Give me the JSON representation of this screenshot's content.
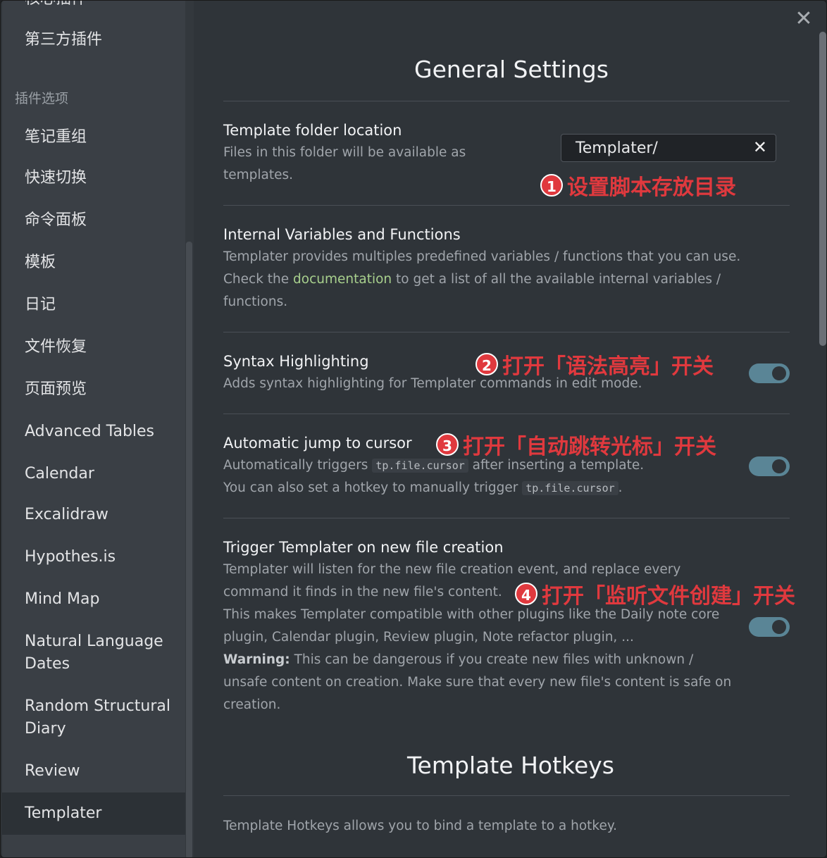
{
  "sidebar": {
    "top_partial": "核心插件",
    "items_top": [
      "第三方插件"
    ],
    "section_label": "插件选项",
    "items": [
      "笔记重组",
      "快速切换",
      "命令面板",
      "模板",
      "日记",
      "文件恢复",
      "页面预览",
      "Advanced Tables",
      "Calendar",
      "Excalidraw",
      "Hypothes.is",
      "Mind Map",
      "Natural Language\nDates",
      "Random Structural\nDiary",
      "Review",
      "Templater"
    ],
    "active": "Templater"
  },
  "dialog": {
    "close_icon": "✕"
  },
  "general": {
    "heading": "General Settings",
    "folder": {
      "title": "Template folder location",
      "desc": "Files in this folder will be available as templates.",
      "value": "Templater/",
      "clear_icon": "✕"
    },
    "internal": {
      "title": "Internal Variables and Functions",
      "desc1": "Templater provides multiples predefined variables / functions that you can use.",
      "desc2_pre": "Check the ",
      "desc2_link": "documentation",
      "desc2_post": " to get a list of all the available internal variables / functions."
    },
    "syntax": {
      "title": "Syntax Highlighting",
      "desc": "Adds syntax highlighting for Templater commands in edit mode.",
      "enabled": true
    },
    "jump": {
      "title": "Automatic jump to cursor",
      "desc_a": "Automatically triggers ",
      "code": "tp.file.cursor",
      "desc_b": " after inserting a template.",
      "desc_c": "You can also set a hotkey to manually trigger ",
      "desc_d": ".",
      "enabled": true
    },
    "trigger": {
      "title": "Trigger Templater on new file creation",
      "desc1": "Templater will listen for the new file creation event, and replace every",
      "desc2": "command it finds in the new file's content.",
      "desc3": "This makes Templater compatible with other plugins like the Daily note core",
      "desc4": "plugin, Calendar plugin, Review plugin, Note refactor plugin, ...",
      "warn_label": "Warning:",
      "desc5": " This can be dangerous if you create new files with unknown /",
      "desc6": "unsafe content on creation. Make sure that every new file's content is safe on",
      "desc7": "creation.",
      "enabled": true
    }
  },
  "hotkeys": {
    "heading": "Template Hotkeys",
    "desc": "Template Hotkeys allows you to bind a template to a hotkey."
  },
  "annotations": [
    {
      "num": "1",
      "text": "设置脚本存放目录"
    },
    {
      "num": "2",
      "text": "打开「语法高亮」开关"
    },
    {
      "num": "3",
      "text": "打开「自动跳转光标」开关"
    },
    {
      "num": "4",
      "text": "打开「监听文件创建」开关"
    }
  ],
  "colors": {
    "accent_toggle": "#5a8596",
    "annotation": "#e0393e",
    "link": "#a8d08d"
  }
}
